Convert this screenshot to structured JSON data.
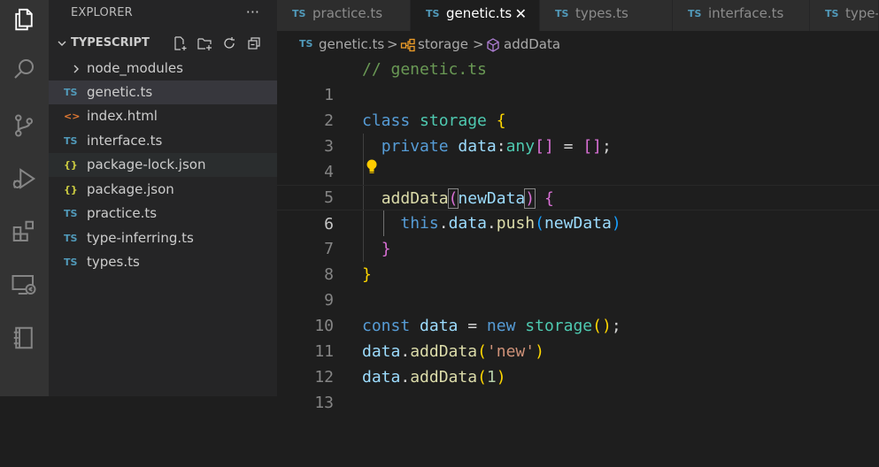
{
  "explorer": {
    "title": "EXPLORER",
    "more": "···",
    "section": "TYPESCRIPT",
    "items": [
      {
        "label": "node_modules",
        "icon": "chevron-right-icon",
        "type": "folder"
      },
      {
        "label": "genetic.ts",
        "icon": "TS",
        "type": "ts"
      },
      {
        "label": "index.html",
        "icon": "<>",
        "type": "html"
      },
      {
        "label": "interface.ts",
        "icon": "TS",
        "type": "ts"
      },
      {
        "label": "package-lock.json",
        "icon": "{}",
        "type": "json"
      },
      {
        "label": "package.json",
        "icon": "{}",
        "type": "json"
      },
      {
        "label": "practice.ts",
        "icon": "TS",
        "type": "ts"
      },
      {
        "label": "type-inferring.ts",
        "icon": "TS",
        "type": "ts"
      },
      {
        "label": "types.ts",
        "icon": "TS",
        "type": "ts"
      }
    ]
  },
  "tabs": [
    {
      "label": "practice.ts",
      "icon": "TS"
    },
    {
      "label": "genetic.ts",
      "icon": "TS",
      "active": true
    },
    {
      "label": "types.ts",
      "icon": "TS"
    },
    {
      "label": "interface.ts",
      "icon": "TS"
    },
    {
      "label": "type-",
      "icon": "TS"
    }
  ],
  "breadcrumb": {
    "file": "genetic.ts",
    "file_icon": "TS",
    "class": "storage",
    "method": "addData",
    "separator": ">"
  },
  "editor": {
    "current_line": 6,
    "lines": [
      {
        "n": "1"
      },
      {
        "n": "2"
      },
      {
        "n": "3"
      },
      {
        "n": "4"
      },
      {
        "n": "5"
      },
      {
        "n": "6"
      },
      {
        "n": "7"
      },
      {
        "n": "8"
      },
      {
        "n": "9"
      },
      {
        "n": "10"
      },
      {
        "n": "11"
      },
      {
        "n": "12"
      },
      {
        "n": "13"
      }
    ],
    "tokens": {
      "l1_comment": "// genetic.ts",
      "l3_class": "class",
      "l3_name": "storage",
      "l3_brace": "{",
      "l4_private": "private",
      "l4_data": "data",
      "l4_colon": ":",
      "l4_any": "any",
      "l4_brackets": "[]",
      "l4_eq": " = ",
      "l4_arr": "[]",
      "l4_semi": ";",
      "l6_fn": "addData",
      "l6_open": "(",
      "l6_param": "newData",
      "l6_close": ")",
      "l6_brace": "{",
      "l7_this": "this",
      "l7_dot1": ".",
      "l7_data": "data",
      "l7_dot2": ".",
      "l7_push": "push",
      "l7_open": "(",
      "l7_arg": "newData",
      "l7_close": ")",
      "l8_brace": "}",
      "l9_brace": "}",
      "l11_const": "const",
      "l11_data": "data",
      "l11_eq": " = ",
      "l11_new": "new",
      "l11_cls": "storage",
      "l11_parens": "()",
      "l11_semi": ";",
      "l12_data": "data",
      "l12_dot": ".",
      "l12_fn": "addData",
      "l12_open": "(",
      "l12_str": "'new'",
      "l12_close": ")",
      "l13_data": "data",
      "l13_dot": ".",
      "l13_fn": "addData",
      "l13_open": "(",
      "l13_num": "1",
      "l13_close": ")"
    }
  },
  "colors": {
    "activity_bar": "#333333",
    "sidebar": "#252526",
    "editor": "#1e1e1e",
    "ts_icon": "#519aba"
  }
}
